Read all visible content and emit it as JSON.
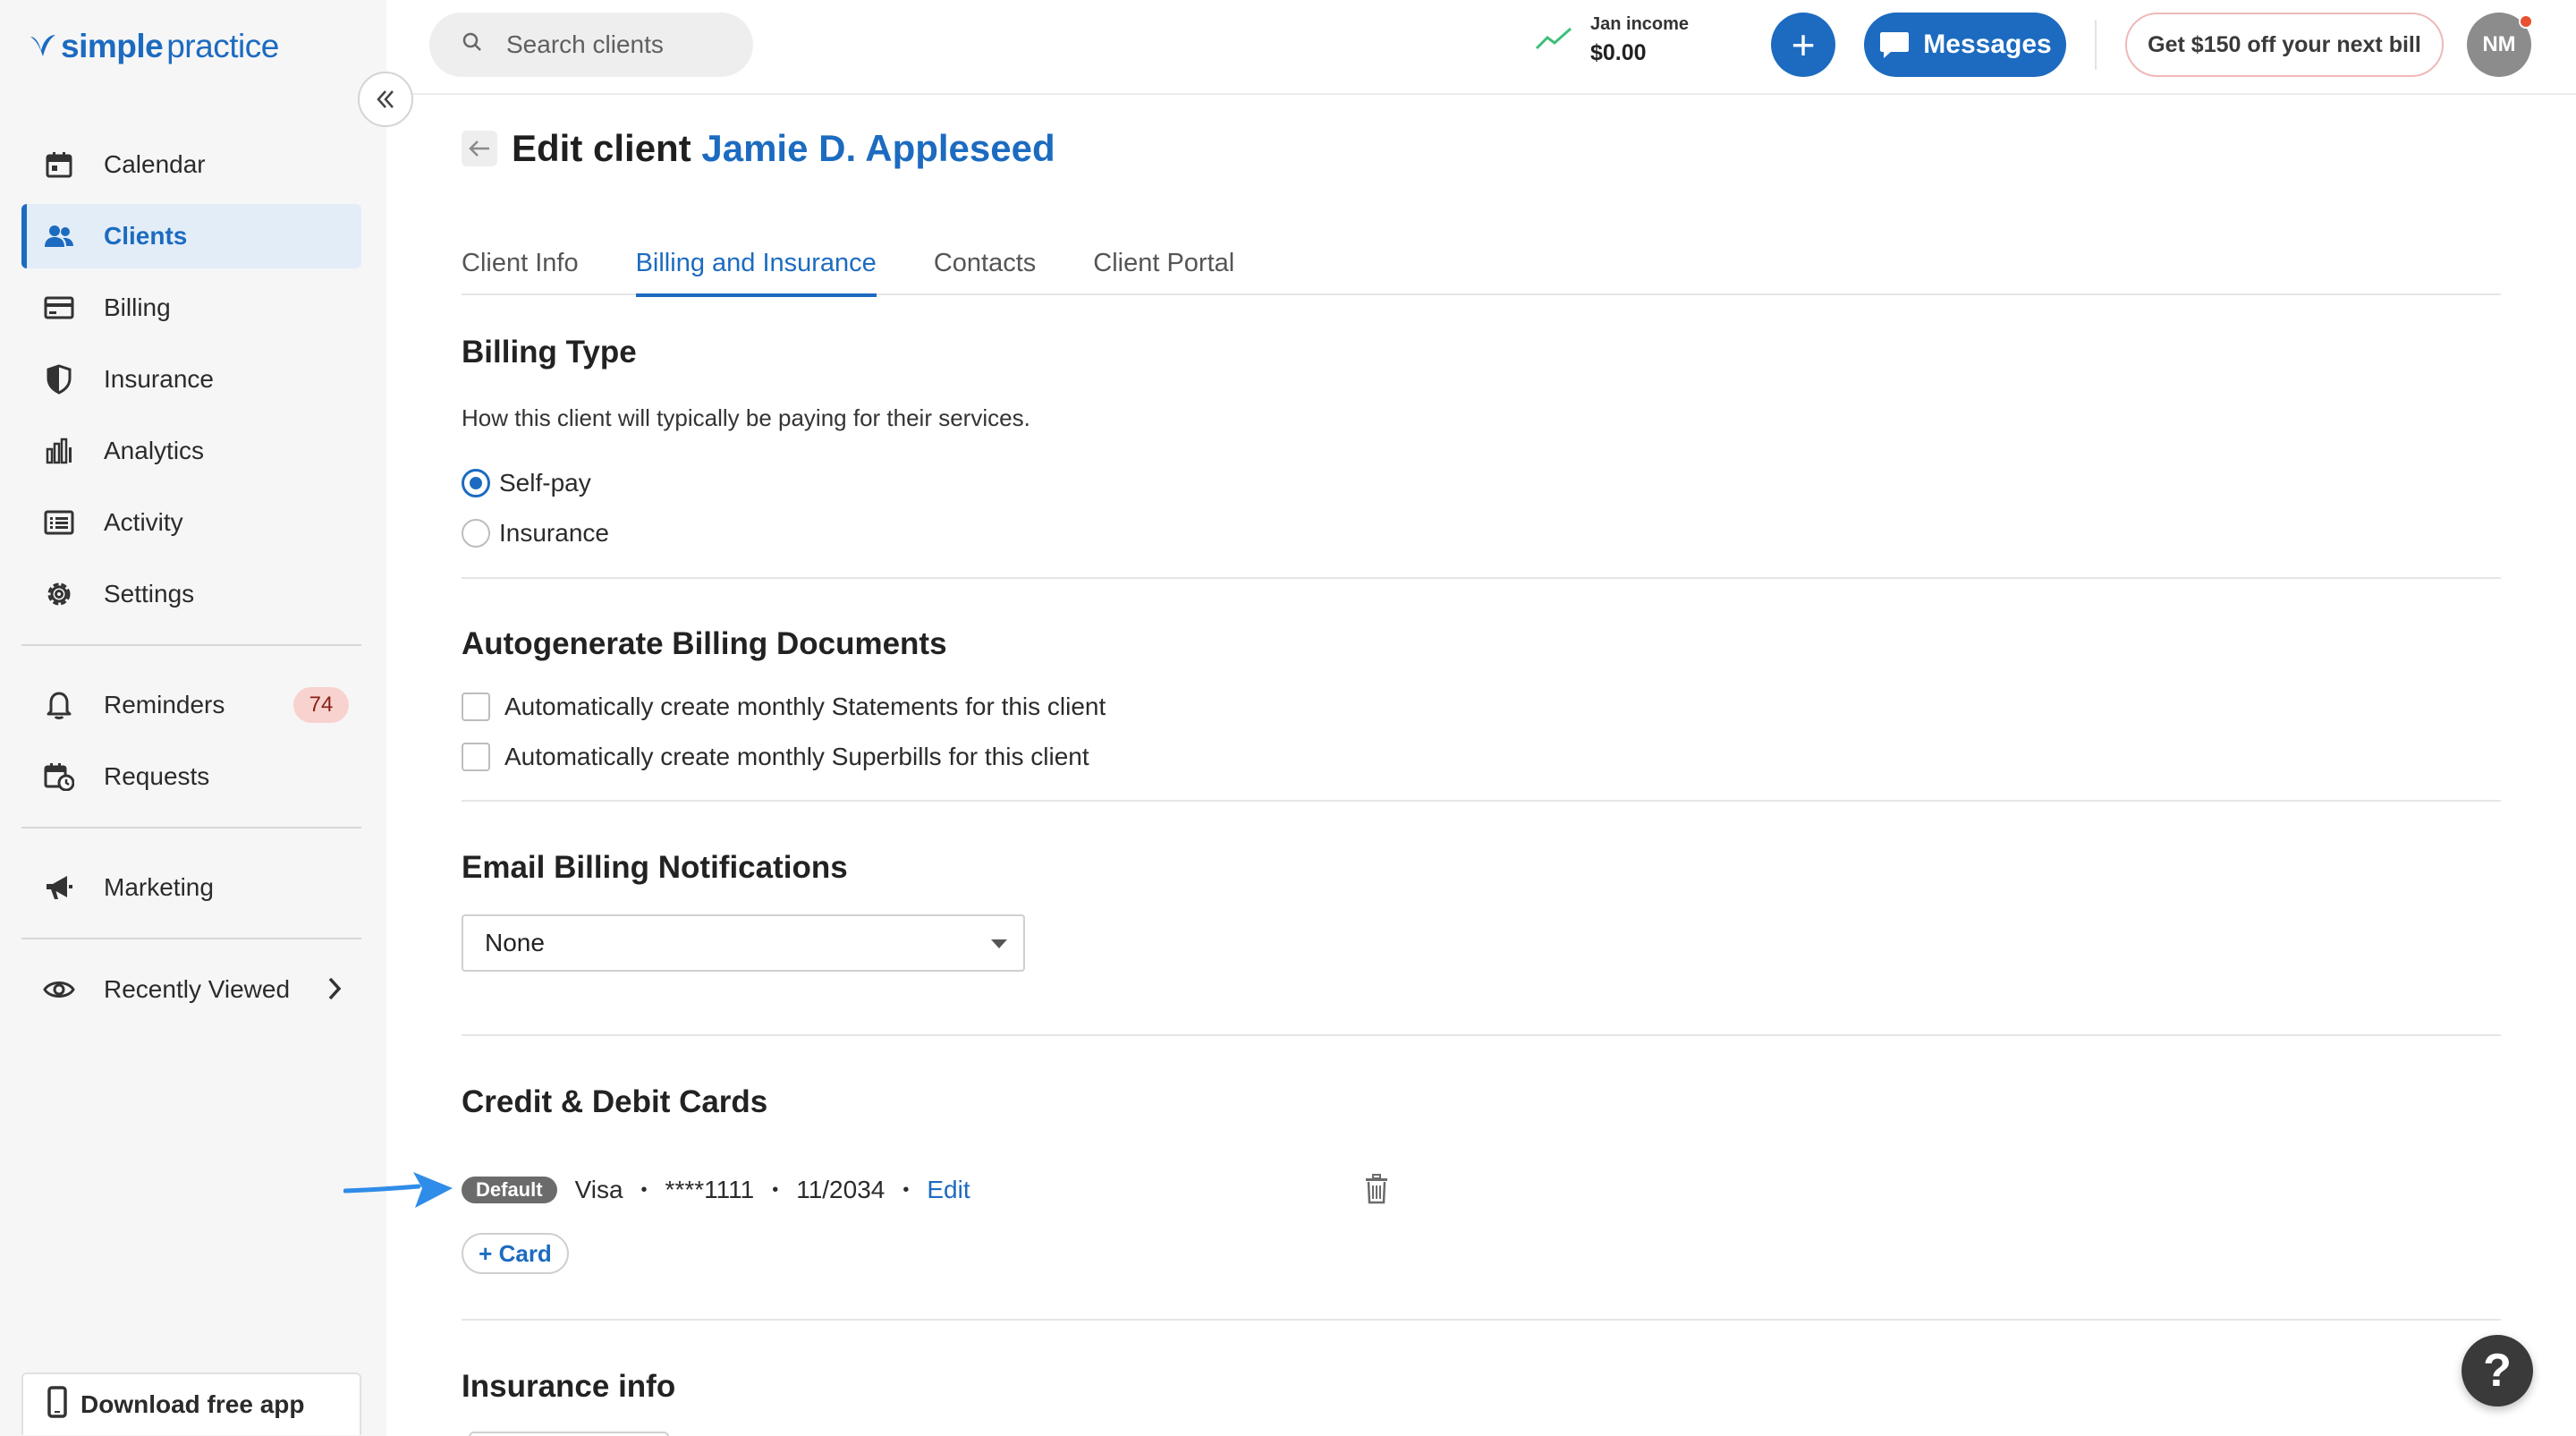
{
  "brand": {
    "name_part1": "simple",
    "name_part2": "practice",
    "color": "#1c6bc0"
  },
  "sidebar": {
    "items": [
      {
        "label": "Calendar",
        "icon": "calendar-icon"
      },
      {
        "label": "Clients",
        "icon": "users-icon",
        "active": true
      },
      {
        "label": "Billing",
        "icon": "credit-card-icon"
      },
      {
        "label": "Insurance",
        "icon": "shield-icon"
      },
      {
        "label": "Analytics",
        "icon": "bar-chart-icon"
      },
      {
        "label": "Activity",
        "icon": "list-icon"
      },
      {
        "label": "Settings",
        "icon": "gear-icon"
      }
    ],
    "reminders": {
      "label": "Reminders",
      "count": "74"
    },
    "requests": {
      "label": "Requests"
    },
    "marketing": {
      "label": "Marketing"
    },
    "recently_viewed": {
      "label": "Recently Viewed"
    },
    "download_app": "Download free app"
  },
  "topbar": {
    "search_placeholder": "Search clients",
    "income_label": "Jan income",
    "income_value": "$0.00",
    "add_label": "+",
    "messages_label": "Messages",
    "promo_label": "Get $150 off your next bill",
    "avatar_initials": "NM"
  },
  "page": {
    "title_prefix": "Edit client",
    "client_name": "Jamie D. Appleseed",
    "tabs": [
      {
        "label": "Client Info"
      },
      {
        "label": "Billing and Insurance",
        "active": true
      },
      {
        "label": "Contacts"
      },
      {
        "label": "Client Portal"
      }
    ]
  },
  "billing_type": {
    "title": "Billing Type",
    "description": "How this client will typically be paying for their services.",
    "options": [
      {
        "label": "Self-pay",
        "checked": true
      },
      {
        "label": "Insurance",
        "checked": false
      }
    ]
  },
  "autogenerate": {
    "title": "Autogenerate Billing Documents",
    "options": [
      {
        "label": "Automatically create monthly Statements for this client",
        "checked": false
      },
      {
        "label": "Automatically create monthly Superbills for this client",
        "checked": false
      }
    ]
  },
  "email_notifications": {
    "title": "Email Billing Notifications",
    "selected": "None"
  },
  "cards": {
    "title": "Credit & Debit Cards",
    "items": [
      {
        "badge": "Default",
        "brand": "Visa",
        "number": "****1111",
        "expiry": "11/2034",
        "edit_label": "Edit"
      }
    ],
    "add_label": "+ Card"
  },
  "insurance_info": {
    "title": "Insurance info"
  },
  "help_label": "?"
}
